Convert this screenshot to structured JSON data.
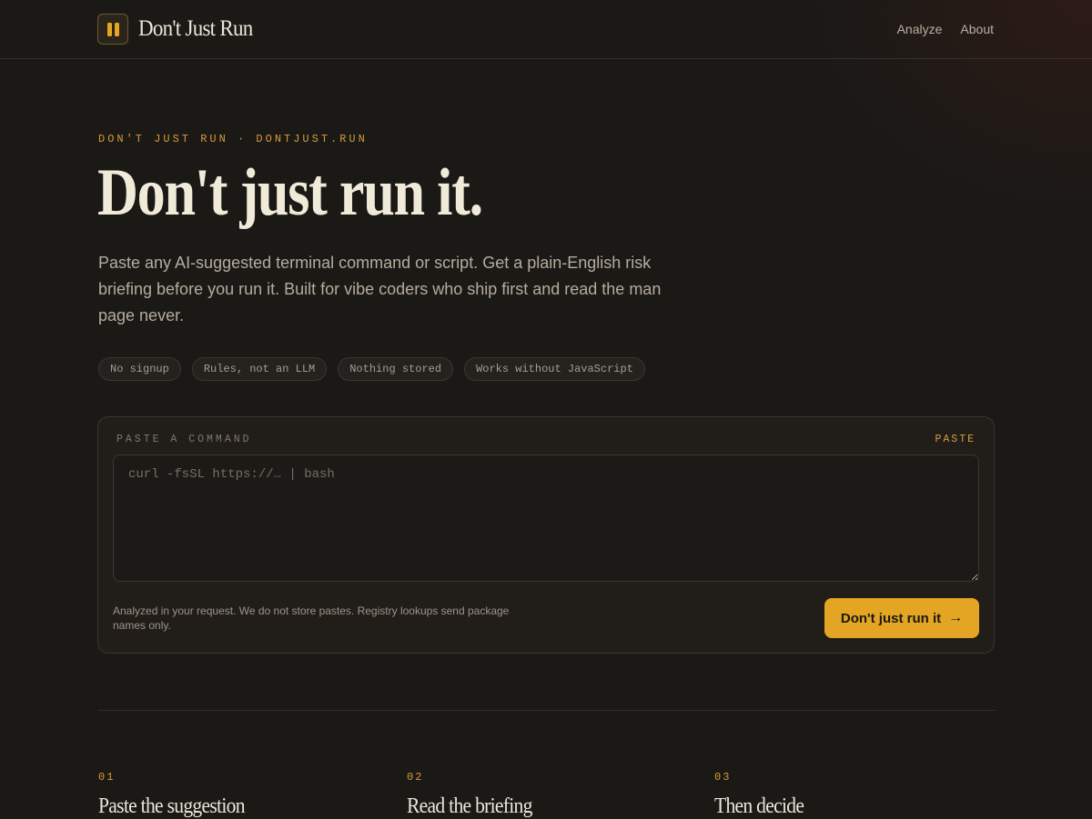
{
  "header": {
    "brand": "Don't Just Run",
    "nav": [
      {
        "label": "Analyze"
      },
      {
        "label": "About"
      }
    ]
  },
  "hero": {
    "eyebrow": "DON'T JUST RUN · DONTJUST.RUN",
    "title": "Don't just run it.",
    "lead": "Paste any AI-suggested terminal command or script. Get a plain-English risk briefing before you run it. Built for vibe coders who ship first and read the man page never.",
    "tags": [
      "No signup",
      "Rules, not an LLM",
      "Nothing stored",
      "Works without JavaScript"
    ]
  },
  "form": {
    "label": "PASTE A COMMAND",
    "paste_label": "PASTE",
    "placeholder": "curl -fsSL https://… | bash",
    "value": "",
    "note": "Analyzed in your request. We do not store pastes. Registry lookups send package names only.",
    "submit_label": "Don't just run it",
    "submit_arrow": "→"
  },
  "steps": [
    {
      "num": "01",
      "title": "Paste the suggestion"
    },
    {
      "num": "02",
      "title": "Read the briefing"
    },
    {
      "num": "03",
      "title": "Then decide"
    }
  ],
  "colors": {
    "accent": "#e3a523",
    "background": "#1b1916",
    "eyebrow": "#d99a3a"
  },
  "icons": {
    "logo": "pause-icon",
    "submit": "arrow-right-icon"
  }
}
